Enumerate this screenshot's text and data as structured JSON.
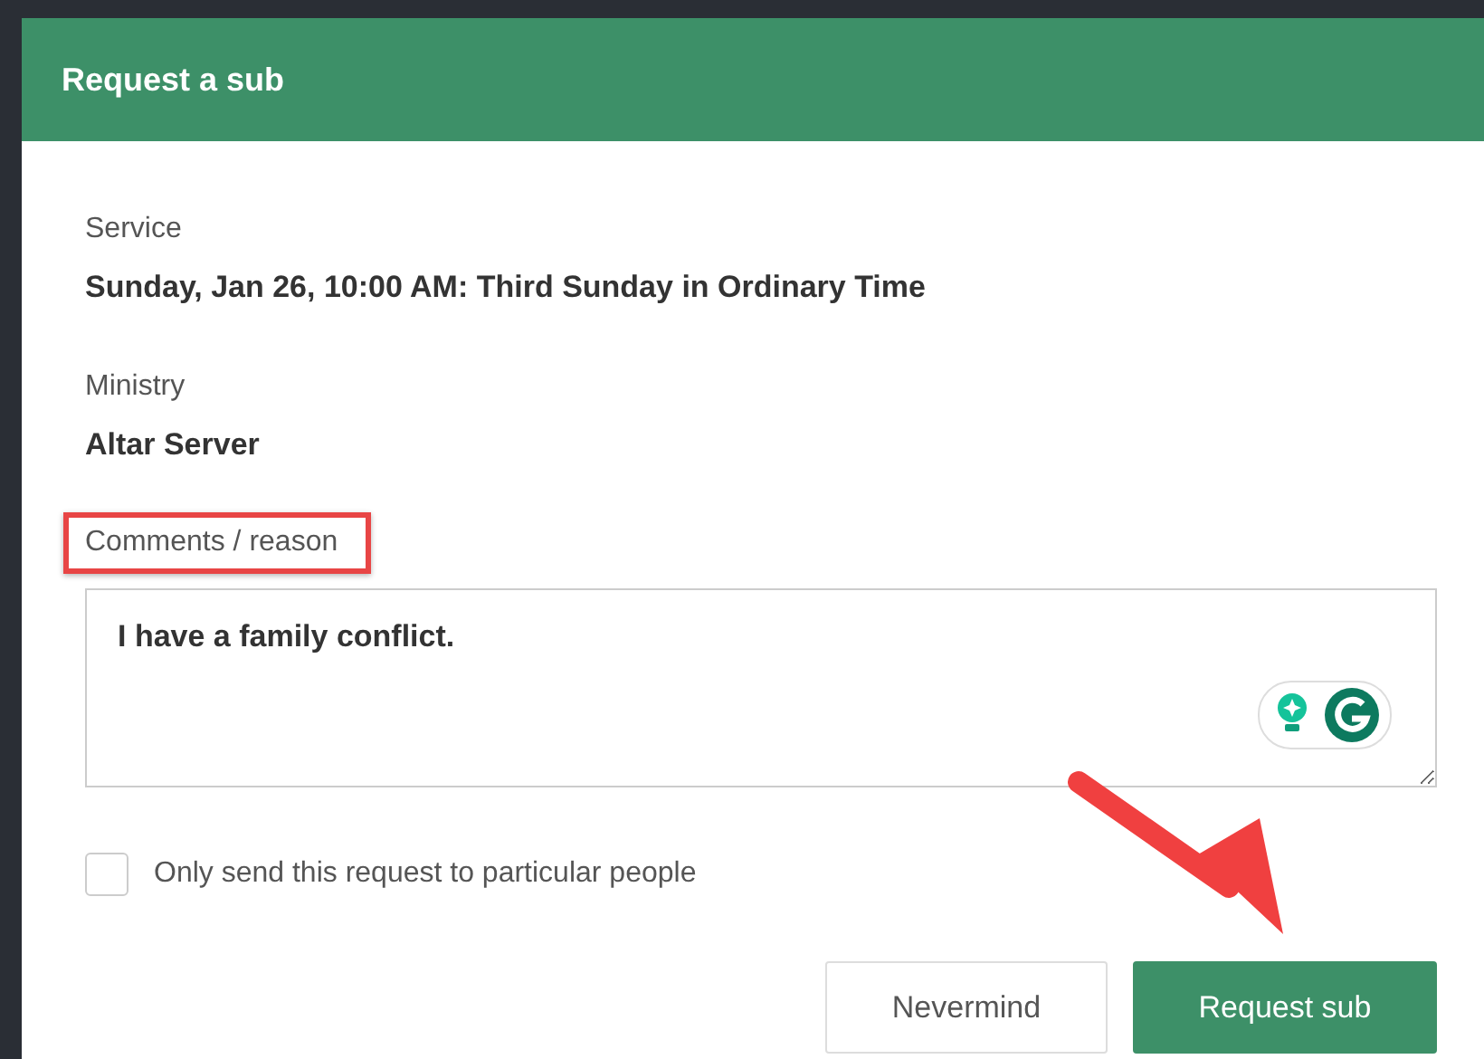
{
  "dialog": {
    "title": "Request a sub"
  },
  "fields": [
    {
      "label": "Service",
      "value": "Sunday, Jan 26, 10:00 AM: Third Sunday in Ordinary Time"
    },
    {
      "label": "Ministry",
      "value": "Altar Server"
    }
  ],
  "comments": {
    "label": "Comments / reason",
    "value": "I have a family conflict.",
    "highlighted": true
  },
  "option": {
    "label": "Only send this request to particular people",
    "checked": false
  },
  "buttons": [
    {
      "label": "Nevermind",
      "kind": "secondary"
    },
    {
      "label": "Request sub",
      "kind": "primary"
    }
  ],
  "annotations": [
    {
      "kind": "arrow"
    }
  ]
}
